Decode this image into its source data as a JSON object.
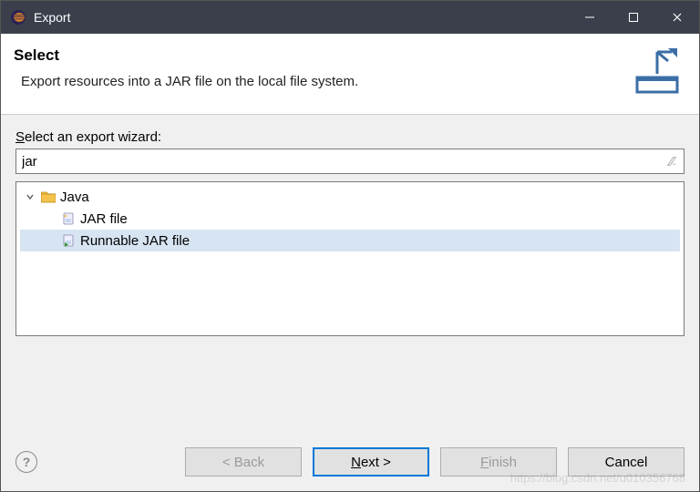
{
  "titlebar": {
    "title": "Export"
  },
  "header": {
    "title": "Select",
    "subtitle": "Export resources into a JAR file on the local file system."
  },
  "body": {
    "label_prefix": "S",
    "label_rest": "elect an export wizard:",
    "filter_value": "jar",
    "tree": {
      "parent": "Java",
      "items": [
        "JAR file",
        "Runnable JAR file"
      ]
    }
  },
  "buttons": {
    "back": "< Back",
    "next_mn": "N",
    "next_rest": "ext >",
    "finish_mn": "F",
    "finish_rest": "inish",
    "cancel": "Cancel"
  },
  "watermark": "https://blog.csdn.net/u010356768"
}
